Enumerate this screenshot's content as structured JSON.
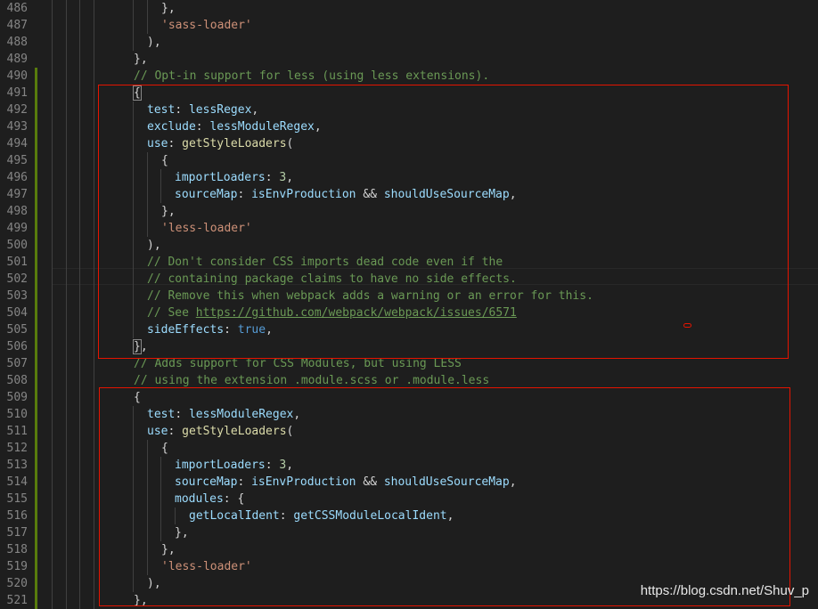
{
  "editor": {
    "colors": {
      "background": "#1e1e1e",
      "line_number": "#858585",
      "modified_gutter": "#587c0c",
      "annotation": "#e51400"
    },
    "lines": [
      {
        "num": "486",
        "modified": false,
        "indent": 3,
        "tokens": [
          {
            "t": "},",
            "c": "tok-p"
          }
        ]
      },
      {
        "num": "487",
        "modified": false,
        "indent": 3,
        "tokens": [
          {
            "t": "'sass-loader'",
            "c": "tok-str"
          }
        ]
      },
      {
        "num": "488",
        "modified": false,
        "indent": 2,
        "tokens": [
          {
            "t": "),",
            "c": "tok-p"
          }
        ]
      },
      {
        "num": "489",
        "modified": false,
        "indent": 1,
        "tokens": [
          {
            "t": "},",
            "c": "tok-p"
          }
        ]
      },
      {
        "num": "490",
        "modified": true,
        "indent": 1,
        "tokens": [
          {
            "t": "// Opt-in support for less (using less extensions).",
            "c": "tok-com"
          }
        ]
      },
      {
        "num": "491",
        "modified": true,
        "indent": 1,
        "tokens": [
          {
            "t": "{",
            "c": "tok-p bracket-match"
          }
        ]
      },
      {
        "num": "492",
        "modified": true,
        "indent": 2,
        "tokens": [
          {
            "t": "test",
            "c": "tok-key"
          },
          {
            "t": ": ",
            "c": "tok-p"
          },
          {
            "t": "lessRegex",
            "c": "tok-id"
          },
          {
            "t": ",",
            "c": "tok-p"
          }
        ]
      },
      {
        "num": "493",
        "modified": true,
        "indent": 2,
        "tokens": [
          {
            "t": "exclude",
            "c": "tok-key"
          },
          {
            "t": ": ",
            "c": "tok-p"
          },
          {
            "t": "lessModuleRegex",
            "c": "tok-id"
          },
          {
            "t": ",",
            "c": "tok-p"
          }
        ]
      },
      {
        "num": "494",
        "modified": true,
        "indent": 2,
        "tokens": [
          {
            "t": "use",
            "c": "tok-key"
          },
          {
            "t": ": ",
            "c": "tok-p"
          },
          {
            "t": "getStyleLoaders",
            "c": "tok-fn"
          },
          {
            "t": "(",
            "c": "tok-p"
          }
        ]
      },
      {
        "num": "495",
        "modified": true,
        "indent": 3,
        "tokens": [
          {
            "t": "{",
            "c": "tok-p"
          }
        ]
      },
      {
        "num": "496",
        "modified": true,
        "indent": 4,
        "tokens": [
          {
            "t": "importLoaders",
            "c": "tok-key"
          },
          {
            "t": ": ",
            "c": "tok-p"
          },
          {
            "t": "3",
            "c": "tok-num"
          },
          {
            "t": ",",
            "c": "tok-p"
          }
        ]
      },
      {
        "num": "497",
        "modified": true,
        "indent": 4,
        "tokens": [
          {
            "t": "sourceMap",
            "c": "tok-key"
          },
          {
            "t": ": ",
            "c": "tok-p"
          },
          {
            "t": "isEnvProduction",
            "c": "tok-id"
          },
          {
            "t": " && ",
            "c": "tok-p"
          },
          {
            "t": "shouldUseSourceMap",
            "c": "tok-id"
          },
          {
            "t": ",",
            "c": "tok-p"
          }
        ]
      },
      {
        "num": "498",
        "modified": true,
        "indent": 3,
        "tokens": [
          {
            "t": "},",
            "c": "tok-p"
          }
        ]
      },
      {
        "num": "499",
        "modified": true,
        "indent": 3,
        "tokens": [
          {
            "t": "'less-loader'",
            "c": "tok-str"
          }
        ]
      },
      {
        "num": "500",
        "modified": true,
        "indent": 2,
        "tokens": [
          {
            "t": "),",
            "c": "tok-p"
          }
        ]
      },
      {
        "num": "501",
        "modified": true,
        "indent": 2,
        "tokens": [
          {
            "t": "// Don't consider CSS imports dead code even if the",
            "c": "tok-com"
          }
        ]
      },
      {
        "num": "502",
        "modified": true,
        "indent": 2,
        "tokens": [
          {
            "t": "// containing package claims to have no side effects.",
            "c": "tok-com"
          }
        ]
      },
      {
        "num": "503",
        "modified": true,
        "indent": 2,
        "tokens": [
          {
            "t": "// Remove this when webpack adds a warning or an error for this.",
            "c": "tok-com"
          }
        ]
      },
      {
        "num": "504",
        "modified": true,
        "indent": 2,
        "tokens": [
          {
            "t": "// See ",
            "c": "tok-com"
          },
          {
            "t": "https://github.com/webpack/webpack/issues/6571",
            "c": "tok-link"
          }
        ]
      },
      {
        "num": "505",
        "modified": true,
        "indent": 2,
        "tokens": [
          {
            "t": "sideEffects",
            "c": "tok-key"
          },
          {
            "t": ": ",
            "c": "tok-p"
          },
          {
            "t": "true",
            "c": "tok-kw"
          },
          {
            "t": ",",
            "c": "tok-p"
          }
        ]
      },
      {
        "num": "506",
        "modified": true,
        "indent": 1,
        "tokens": [
          {
            "t": "}",
            "c": "tok-p bracket-match"
          },
          {
            "t": ",",
            "c": "tok-p"
          }
        ]
      },
      {
        "num": "507",
        "modified": true,
        "indent": 1,
        "tokens": [
          {
            "t": "// Adds support for CSS Modules, but using LESS",
            "c": "tok-com"
          }
        ]
      },
      {
        "num": "508",
        "modified": true,
        "indent": 1,
        "tokens": [
          {
            "t": "// using the extension .module.scss or .module.less",
            "c": "tok-com"
          }
        ]
      },
      {
        "num": "509",
        "modified": true,
        "indent": 1,
        "tokens": [
          {
            "t": "{",
            "c": "tok-p"
          }
        ]
      },
      {
        "num": "510",
        "modified": true,
        "indent": 2,
        "tokens": [
          {
            "t": "test",
            "c": "tok-key"
          },
          {
            "t": ": ",
            "c": "tok-p"
          },
          {
            "t": "lessModuleRegex",
            "c": "tok-id"
          },
          {
            "t": ",",
            "c": "tok-p"
          }
        ]
      },
      {
        "num": "511",
        "modified": true,
        "indent": 2,
        "tokens": [
          {
            "t": "use",
            "c": "tok-key"
          },
          {
            "t": ": ",
            "c": "tok-p"
          },
          {
            "t": "getStyleLoaders",
            "c": "tok-fn"
          },
          {
            "t": "(",
            "c": "tok-p"
          }
        ]
      },
      {
        "num": "512",
        "modified": true,
        "indent": 3,
        "tokens": [
          {
            "t": "{",
            "c": "tok-p"
          }
        ]
      },
      {
        "num": "513",
        "modified": true,
        "indent": 4,
        "tokens": [
          {
            "t": "importLoaders",
            "c": "tok-key"
          },
          {
            "t": ": ",
            "c": "tok-p"
          },
          {
            "t": "3",
            "c": "tok-num"
          },
          {
            "t": ",",
            "c": "tok-p"
          }
        ]
      },
      {
        "num": "514",
        "modified": true,
        "indent": 4,
        "tokens": [
          {
            "t": "sourceMap",
            "c": "tok-key"
          },
          {
            "t": ": ",
            "c": "tok-p"
          },
          {
            "t": "isEnvProduction",
            "c": "tok-id"
          },
          {
            "t": " && ",
            "c": "tok-p"
          },
          {
            "t": "shouldUseSourceMap",
            "c": "tok-id"
          },
          {
            "t": ",",
            "c": "tok-p"
          }
        ]
      },
      {
        "num": "515",
        "modified": true,
        "indent": 4,
        "tokens": [
          {
            "t": "modules",
            "c": "tok-key"
          },
          {
            "t": ": {",
            "c": "tok-p"
          }
        ]
      },
      {
        "num": "516",
        "modified": true,
        "indent": 5,
        "tokens": [
          {
            "t": "getLocalIdent",
            "c": "tok-key"
          },
          {
            "t": ": ",
            "c": "tok-p"
          },
          {
            "t": "getCSSModuleLocalIdent",
            "c": "tok-id"
          },
          {
            "t": ",",
            "c": "tok-p"
          }
        ]
      },
      {
        "num": "517",
        "modified": true,
        "indent": 4,
        "tokens": [
          {
            "t": "},",
            "c": "tok-p"
          }
        ]
      },
      {
        "num": "518",
        "modified": true,
        "indent": 3,
        "tokens": [
          {
            "t": "},",
            "c": "tok-p"
          }
        ]
      },
      {
        "num": "519",
        "modified": true,
        "indent": 3,
        "tokens": [
          {
            "t": "'less-loader'",
            "c": "tok-str"
          }
        ]
      },
      {
        "num": "520",
        "modified": true,
        "indent": 2,
        "tokens": [
          {
            "t": "),",
            "c": "tok-p"
          }
        ]
      },
      {
        "num": "521",
        "modified": true,
        "indent": 1,
        "tokens": [
          {
            "t": "},",
            "c": "tok-p"
          }
        ]
      }
    ]
  },
  "watermark": "https://blog.csdn.net/Shuv_p"
}
